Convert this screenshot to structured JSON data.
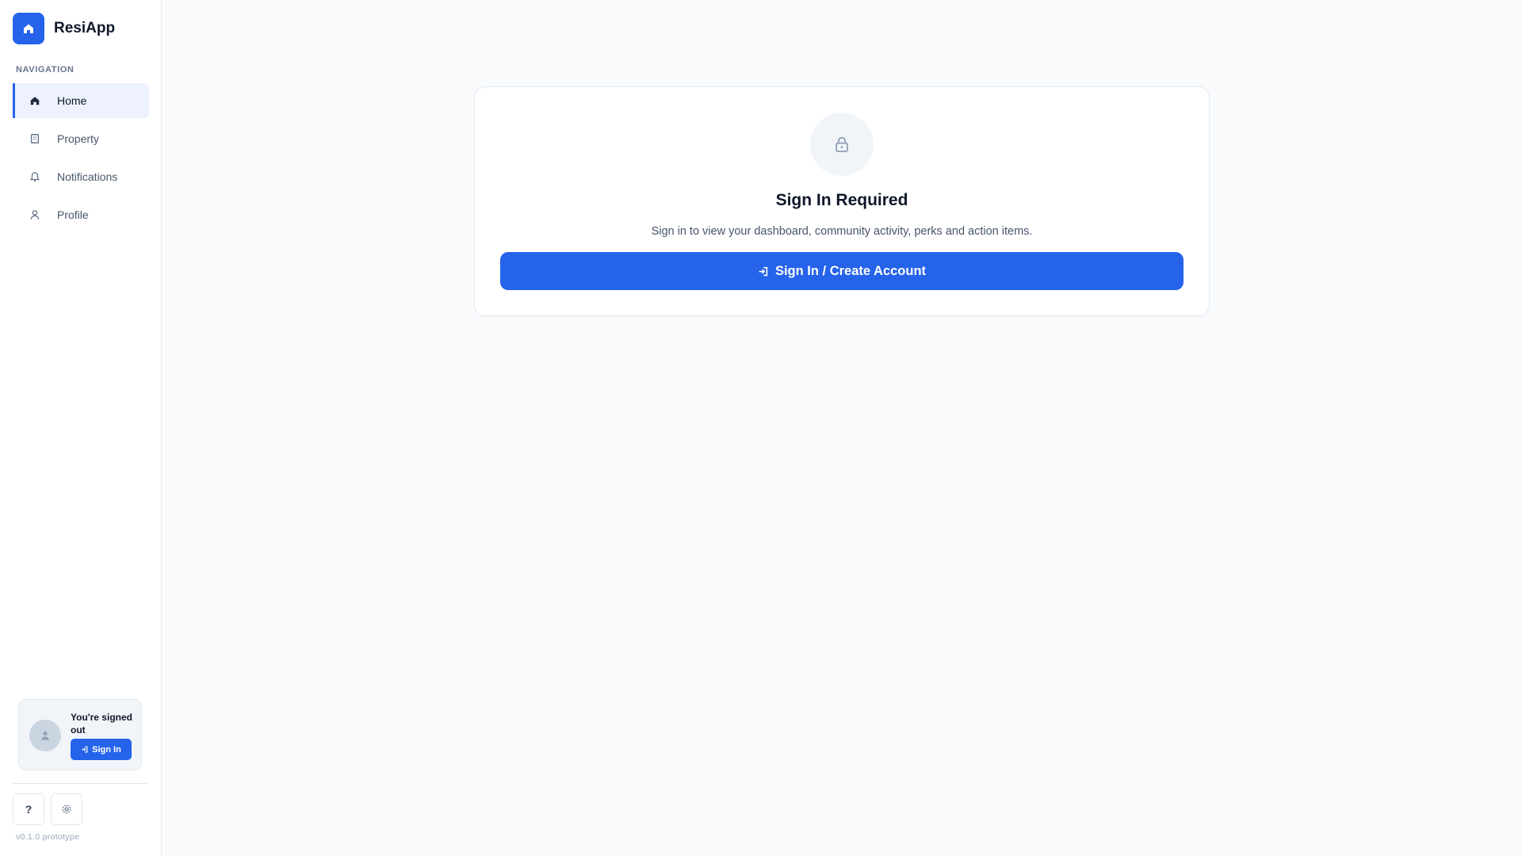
{
  "app": {
    "name": "ResiApp",
    "logo_icon": "home-icon",
    "accent_color": "#2563eb"
  },
  "sidebar": {
    "section_label": "NAVIGATION",
    "items": [
      {
        "label": "Home",
        "icon": "home-icon",
        "active": true
      },
      {
        "label": "Property",
        "icon": "building-icon",
        "active": false
      },
      {
        "label": "Notifications",
        "icon": "bell-icon",
        "active": false
      },
      {
        "label": "Profile",
        "icon": "user-icon",
        "active": false
      }
    ],
    "signed_out_card": {
      "title": "You're signed out",
      "button_label": "Sign In",
      "avatar_icon": "user-icon",
      "button_icon": "sign-in-icon"
    },
    "footer": {
      "help_label": "?",
      "settings_icon": "gear-icon",
      "version": "v0.1.0 prototype"
    }
  },
  "main": {
    "card": {
      "icon": "lock-icon",
      "title": "Sign In Required",
      "description": "Sign in to view your dashboard, community activity, perks and action items.",
      "button_label": "Sign In / Create Account",
      "button_icon": "sign-in-icon"
    }
  }
}
